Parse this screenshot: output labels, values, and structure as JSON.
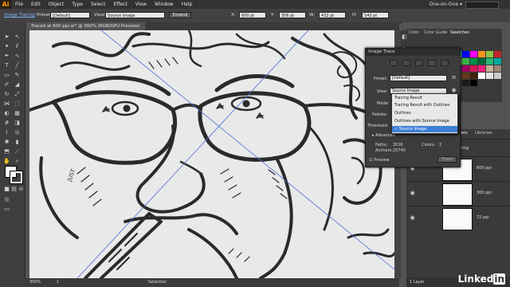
{
  "app": {
    "logo": "Ai",
    "workspace": "One-on-One ▾"
  },
  "menu": [
    "File",
    "Edit",
    "Object",
    "Type",
    "Select",
    "Effect",
    "View",
    "Window",
    "Help"
  ],
  "control_bar": {
    "title": "Image Tracing",
    "preset_label": "Preset:",
    "preset_value": "[Default]",
    "view_label": "View:",
    "view_value": "Source Image",
    "expand_label": "Expand",
    "x_label": "X:",
    "x_value": "600 pt",
    "y_label": "Y:",
    "y_value": "306 pt",
    "w_label": "W:",
    "w_value": "432 pt",
    "h_label": "H:",
    "h_value": "540 pt"
  },
  "document_tab": "Traced at 600 ppi.ai* @ 300% (RGB/GPU Preview)",
  "status_bar": {
    "zoom": "300%",
    "page": "1",
    "mode": "Selection"
  },
  "image_trace": {
    "title": "Image Trace",
    "preset_label": "Preset:",
    "preset_value": "[Default]",
    "view_label": "View:",
    "view_value": "Source Image",
    "mode_label": "Mode:",
    "palette_label": "Palette:",
    "threshold_label": "Threshold:",
    "advanced_label": "Advanced",
    "paths_label": "Paths:",
    "paths_value": "3016",
    "anchors_label": "Anchors:",
    "anchors_value": "25740",
    "colors_label": "Colors:",
    "colors_value": "2",
    "preview_label": "Preview",
    "trace_button": "Trace"
  },
  "view_menu": {
    "items": [
      "Tracing Result",
      "Tracing Result with Outlines",
      "Outlines",
      "Outlines with Source Image",
      "Source Image"
    ],
    "checked": "Source Image",
    "highlighted_index": 4
  },
  "swatch_panel": {
    "tabs": [
      "Color",
      "Color Guide",
      "Swatches"
    ],
    "colors": [
      "#ffffff",
      "#000000",
      "#ff0000",
      "#ffff00",
      "#00ff00",
      "#00ffff",
      "#0000ff",
      "#ff00ff",
      "#f7931e",
      "#8cc63f",
      "#c1272d",
      "#ed1c24",
      "#f15a24",
      "#fbb03b",
      "#fcee21",
      "#d9e021",
      "#8cc63f",
      "#39b54a",
      "#009245",
      "#006837",
      "#22b573",
      "#00a99d",
      "#29abe2",
      "#0071bc",
      "#2e3192",
      "#1b1464",
      "#662d91",
      "#93278f",
      "#9e005d",
      "#d4145a",
      "#ed1e79",
      "#c7b299",
      "#998675",
      "#736357",
      "#534741",
      "#c69c6d",
      "#a67c52",
      "#8c6239",
      "#754c24",
      "#603813",
      "#42210b",
      "#ffffff",
      "#e6e6e6",
      "#cccccc",
      "#b3b3b3",
      "#999999",
      "#808080",
      "#666666",
      "#4d4d4d",
      "#333333",
      "#1a1a1a",
      "#000000"
    ]
  },
  "layers_panel": {
    "tabs": [
      "Layers",
      "Libraries"
    ],
    "rows": [
      {
        "name": "Tracing"
      },
      {
        "name": "600 ppi"
      },
      {
        "name": "300 ppi"
      },
      {
        "name": "72 ppi"
      }
    ],
    "footer": "1 Layer"
  },
  "watermark": {
    "text": "Linked",
    "in": "in"
  }
}
